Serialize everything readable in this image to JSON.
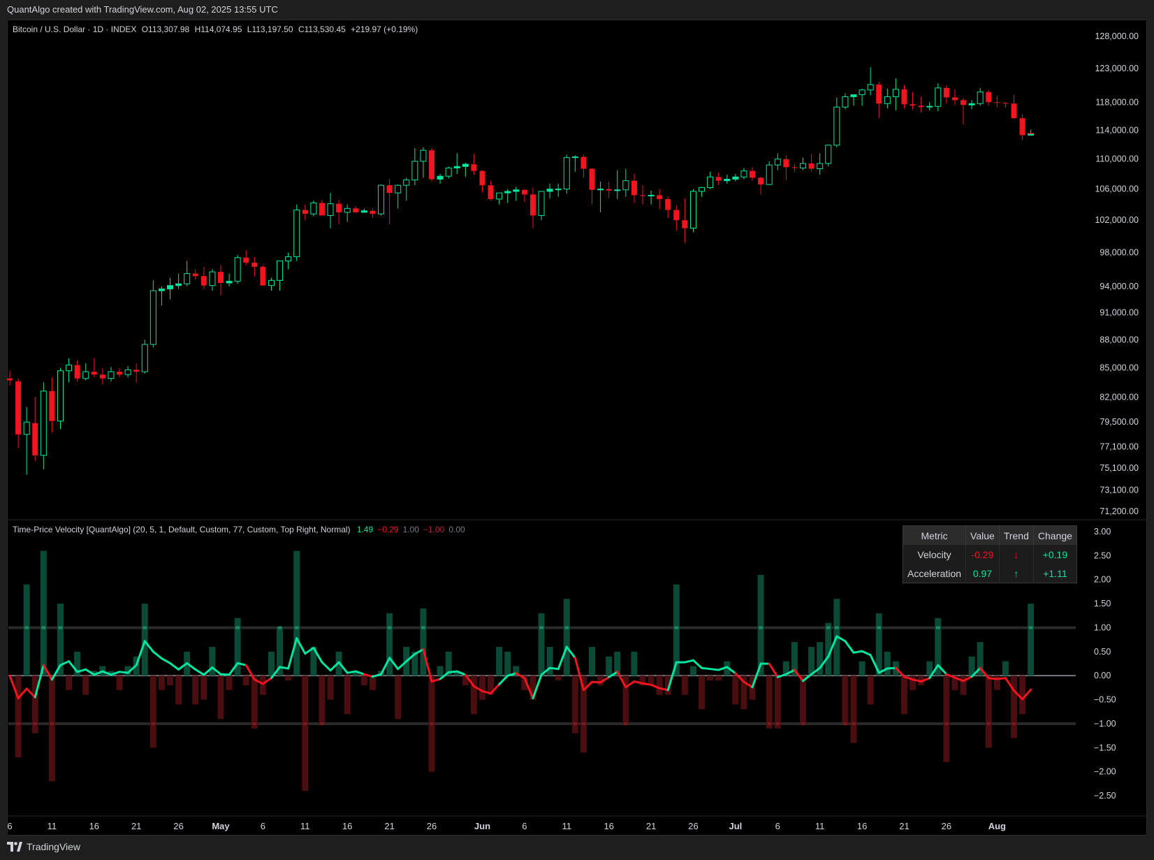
{
  "header": {
    "watermark": "QuantAlgo created with TradingView.com, Aug 02, 2025 13:55 UTC"
  },
  "symbol": {
    "name": "Bitcoin / U.S. Dollar · 1D · INDEX",
    "open": "O113,307.98",
    "high": "H114,074.95",
    "low": "L113,197.50",
    "close": "C113,530.45",
    "change": "+219.97 (+0.19%)"
  },
  "indicator": {
    "name": "Time-Price Velocity [QuantAlgo] (20, 5, 1, Default, Custom, 77, Custom, Top Right, Normal)",
    "values": [
      {
        "text": "1.49",
        "color": "#00e6a0"
      },
      {
        "text": "−0.29",
        "color": "#f2141e"
      },
      {
        "text": "1.00",
        "color": "#787b86"
      },
      {
        "text": "−1.00",
        "color": "#b22833"
      },
      {
        "text": "0.00",
        "color": "#787b86"
      }
    ]
  },
  "table": {
    "headers": [
      "Metric",
      "Value",
      "Trend",
      "Change"
    ],
    "rows": [
      {
        "metric": "Velocity",
        "value": "-0.29",
        "trend": "↓",
        "change": "+0.19",
        "value_color": "neg",
        "trend_color": "neg",
        "change_color": "pos"
      },
      {
        "metric": "Acceleration",
        "value": "0.97",
        "trend": "↑",
        "change": "+1.11",
        "value_color": "pos",
        "trend_color": "pos",
        "change_color": "pos"
      }
    ]
  },
  "colors": {
    "up": "#00e6a0",
    "down": "#f2141e",
    "background": "#000000"
  },
  "footer": {
    "brand": "TradingView"
  },
  "chart_data": [
    {
      "type": "candlestick",
      "y_ticks": [
        "128,000.00",
        "123,000.00",
        "118,000.00",
        "114,000.00",
        "110,000.00",
        "106,000.00",
        "102,000.00",
        "98,000.00",
        "94,000.00",
        "91,000.00",
        "88,000.00",
        "85,000.00",
        "82,000.00",
        "79,500.00",
        "77,100.00",
        "75,100.00",
        "73,100.00",
        "71,200.00"
      ],
      "y_tick_values": [
        128000,
        123000,
        118000,
        114000,
        110000,
        106000,
        102000,
        98000,
        94000,
        91000,
        88000,
        85000,
        82000,
        79500,
        77100,
        75100,
        73100,
        71200
      ],
      "y_scale": "log",
      "x_ticks": [
        "6",
        "11",
        "16",
        "21",
        "26",
        "May",
        "6",
        "11",
        "16",
        "21",
        "26",
        "Jun",
        "6",
        "11",
        "16",
        "21",
        "26",
        "Jul",
        "6",
        "11",
        "16",
        "21",
        "26",
        "Aug"
      ],
      "x_tick_bars": [
        0,
        5,
        10,
        15,
        20,
        25,
        30,
        35,
        40,
        45,
        50,
        56,
        61,
        66,
        71,
        76,
        81,
        86,
        91,
        96,
        101,
        106,
        111,
        117
      ],
      "candles": [
        [
          83900,
          84700,
          83200,
          83700
        ],
        [
          83600,
          83900,
          77000,
          78300
        ],
        [
          78300,
          81000,
          74500,
          79500
        ],
        [
          79400,
          82000,
          75800,
          76300
        ],
        [
          76300,
          83500,
          75000,
          82600
        ],
        [
          82600,
          84000,
          78500,
          79600
        ],
        [
          79600,
          85000,
          78800,
          84700
        ],
        [
          84700,
          86000,
          83500,
          85300
        ],
        [
          85300,
          85800,
          83600,
          83900
        ],
        [
          83900,
          85500,
          83700,
          84600
        ],
        [
          84600,
          86000,
          84000,
          84300
        ],
        [
          84300,
          85000,
          83300,
          83900
        ],
        [
          83900,
          85100,
          83600,
          84600
        ],
        [
          84600,
          85000,
          84000,
          84300
        ],
        [
          84300,
          85200,
          84000,
          84800
        ],
        [
          84800,
          85500,
          83500,
          84600
        ],
        [
          84600,
          88000,
          84400,
          87500
        ],
        [
          87500,
          94700,
          87200,
          93500
        ],
        [
          93500,
          94000,
          91800,
          93700
        ],
        [
          93700,
          95000,
          92500,
          94100
        ],
        [
          94100,
          95500,
          93700,
          94300
        ],
        [
          94300,
          97000,
          94000,
          95500
        ],
        [
          95500,
          96000,
          94800,
          95200
        ],
        [
          95200,
          96300,
          93700,
          94100
        ],
        [
          94100,
          96000,
          93500,
          95700
        ],
        [
          95700,
          96500,
          93000,
          94400
        ],
        [
          94400,
          95500,
          94000,
          94600
        ],
        [
          94600,
          97700,
          94300,
          97400
        ],
        [
          97400,
          98300,
          96500,
          96800
        ],
        [
          96800,
          97500,
          95200,
          96300
        ],
        [
          96300,
          96500,
          94500,
          94100
        ],
        [
          94100,
          95000,
          93500,
          94700
        ],
        [
          94700,
          97000,
          93500,
          97000
        ],
        [
          97000,
          98000,
          96000,
          97500
        ],
        [
          97500,
          104000,
          97000,
          103300
        ],
        [
          103300,
          104000,
          102000,
          102800
        ],
        [
          102800,
          104500,
          102500,
          104200
        ],
        [
          104200,
          104600,
          102700,
          102600
        ],
        [
          102600,
          105500,
          101000,
          104100
        ],
        [
          104100,
          104600,
          101500,
          103000
        ],
        [
          103000,
          104000,
          101800,
          103500
        ],
        [
          103500,
          103800,
          102900,
          103000
        ],
        [
          103000,
          103500,
          103000,
          103200
        ],
        [
          103200,
          103500,
          102300,
          102800
        ],
        [
          102800,
          106600,
          102600,
          106500
        ],
        [
          106500,
          107300,
          101500,
          105500
        ],
        [
          105500,
          106600,
          103500,
          106500
        ],
        [
          106500,
          107500,
          104500,
          107200
        ],
        [
          107200,
          111500,
          106500,
          109700
        ],
        [
          109700,
          111600,
          107500,
          111200
        ],
        [
          111200,
          111500,
          107000,
          107300
        ],
        [
          107300,
          108000,
          106700,
          107700
        ],
        [
          107700,
          109000,
          107400,
          108800
        ],
        [
          108800,
          110800,
          108000,
          109000
        ],
        [
          109000,
          109500,
          107600,
          109300
        ],
        [
          109300,
          110700,
          107900,
          108400
        ],
        [
          108400,
          108500,
          105600,
          106500
        ],
        [
          106500,
          107100,
          104500,
          104700
        ],
        [
          104700,
          105500,
          104000,
          105500
        ],
        [
          105500,
          106000,
          104200,
          105700
        ],
        [
          105700,
          106300,
          104500,
          105900
        ],
        [
          105900,
          106000,
          104300,
          105300
        ],
        [
          105300,
          106200,
          101000,
          102600
        ],
        [
          102600,
          105600,
          102000,
          105700
        ],
        [
          105700,
          106700,
          104800,
          106000
        ],
        [
          106000,
          106700,
          105000,
          106000
        ],
        [
          106000,
          110600,
          105400,
          110200
        ],
        [
          110200,
          110500,
          108300,
          110300
        ],
        [
          110300,
          110600,
          107500,
          108700
        ],
        [
          108700,
          108800,
          104000,
          105900
        ],
        [
          105900,
          107000,
          103000,
          106000
        ],
        [
          106000,
          107000,
          104800,
          105800
        ],
        [
          105800,
          108500,
          104700,
          105900
        ],
        [
          105900,
          108700,
          105000,
          107100
        ],
        [
          107100,
          108000,
          104200,
          105200
        ],
        [
          105200,
          106500,
          104000,
          105100
        ],
        [
          105100,
          105800,
          104000,
          105200
        ],
        [
          105200,
          106000,
          103400,
          104700
        ],
        [
          104700,
          105000,
          102300,
          103300
        ],
        [
          103300,
          103900,
          100700,
          102000
        ],
        [
          102000,
          104800,
          99200,
          101000
        ],
        [
          101000,
          106000,
          100500,
          105700
        ],
        [
          105700,
          106300,
          105000,
          106200
        ],
        [
          106200,
          108300,
          106000,
          107600
        ],
        [
          107600,
          108200,
          106500,
          107100
        ],
        [
          107100,
          107900,
          106700,
          107300
        ],
        [
          107300,
          108000,
          107000,
          107600
        ],
        [
          107600,
          108800,
          107300,
          108400
        ],
        [
          108400,
          108900,
          107100,
          107500
        ],
        [
          107500,
          107600,
          105300,
          106600
        ],
        [
          106600,
          109700,
          106500,
          109200
        ],
        [
          109200,
          110800,
          108500,
          110000
        ],
        [
          110000,
          110500,
          107200,
          108900
        ],
        [
          108900,
          109300,
          108300,
          108800
        ],
        [
          108800,
          110200,
          108500,
          109400
        ],
        [
          109400,
          110700,
          108300,
          108700
        ],
        [
          108700,
          110800,
          107900,
          109400
        ],
        [
          109400,
          112000,
          109000,
          111900
        ],
        [
          111900,
          118700,
          111600,
          117300
        ],
        [
          117300,
          119300,
          117000,
          118800
        ],
        [
          118800,
          119000,
          117500,
          119100
        ],
        [
          119100,
          120000,
          117500,
          119800
        ],
        [
          119800,
          123200,
          119000,
          120600
        ],
        [
          120600,
          121000,
          115700,
          117800
        ],
        [
          117800,
          120000,
          117100,
          118800
        ],
        [
          118800,
          121500,
          116800,
          119900
        ],
        [
          119900,
          120500,
          117100,
          117700
        ],
        [
          117700,
          119500,
          116900,
          117500
        ],
        [
          117500,
          118800,
          116500,
          117300
        ],
        [
          117300,
          118000,
          116800,
          117400
        ],
        [
          117400,
          120800,
          116700,
          120100
        ],
        [
          120100,
          120500,
          117800,
          118700
        ],
        [
          118700,
          119900,
          117600,
          118300
        ],
        [
          118300,
          118600,
          114800,
          117600
        ],
        [
          117600,
          118300,
          117000,
          117800
        ],
        [
          117800,
          120100,
          117500,
          119500
        ],
        [
          119500,
          119800,
          117500,
          118000
        ],
        [
          118000,
          118900,
          117300,
          117900
        ],
        [
          117900,
          118000,
          117200,
          117800
        ],
        [
          117800,
          119100,
          115600,
          115700
        ],
        [
          115700,
          116300,
          112600,
          113300
        ],
        [
          113300,
          114100,
          113200,
          113530
        ]
      ]
    },
    {
      "type": "line+bar",
      "y_ticks": [
        "3.00",
        "2.50",
        "2.00",
        "1.50",
        "1.00",
        "0.50",
        "0.00",
        "−0.50",
        "−1.00",
        "−1.50",
        "−2.00",
        "−2.50"
      ],
      "y_tick_values": [
        3,
        2.5,
        2,
        1.5,
        1,
        0.5,
        0,
        -0.5,
        -1,
        -1.5,
        -2,
        -2.5
      ],
      "levels": [
        1,
        0,
        -1
      ],
      "velocity": [
        0,
        -0.47,
        -0.27,
        -0.45,
        0.22,
        -0.08,
        0.22,
        0.3,
        0.08,
        0.13,
        0.02,
        0.09,
        0.02,
        0.08,
        0.06,
        0.22,
        0.72,
        0.5,
        0.36,
        0.26,
        0.13,
        0.26,
        0.13,
        0.02,
        0.17,
        0.03,
        0.02,
        0.26,
        0.22,
        -0.08,
        -0.17,
        -0.05,
        0.18,
        0.15,
        0.78,
        0.46,
        0.58,
        0.28,
        0.11,
        0.28,
        0.06,
        0.09,
        0.03,
        -0.02,
        0.03,
        0.37,
        0.14,
        0.3,
        0.45,
        0.55,
        -0.12,
        -0.07,
        0.07,
        0.09,
        0.02,
        -0.22,
        -0.32,
        -0.37,
        -0.18,
        0,
        0.05,
        -0.05,
        -0.47,
        0.02,
        0.16,
        0.14,
        0.6,
        0.37,
        -0.3,
        -0.13,
        -0.14,
        -0.03,
        0.08,
        -0.24,
        -0.12,
        -0.16,
        -0.19,
        -0.26,
        -0.3,
        0.28,
        0.28,
        0.32,
        0.16,
        0.14,
        0.12,
        0.18,
        0.05,
        -0.13,
        -0.24,
        0.25,
        0.25,
        -0.03,
        0.03,
        0.12,
        -0.11,
        0.03,
        0.16,
        0.4,
        0.82,
        0.72,
        0.48,
        0.51,
        0.43,
        0.06,
        0.15,
        0.16,
        -0.02,
        -0.08,
        -0.12,
        -0.05,
        0.22,
        0.03,
        -0.04,
        -0.11,
        -0.02,
        0.16,
        -0.05,
        -0.07,
        -0.05,
        -0.31,
        -0.49,
        -0.29
      ],
      "acceleration": [
        0,
        -1.7,
        1.9,
        -1.2,
        2.6,
        -2.2,
        1.5,
        -0.3,
        0.5,
        -0.4,
        0.1,
        0.2,
        0.1,
        -0.3,
        0.2,
        0.4,
        1.5,
        -1.5,
        -0.3,
        -0.2,
        -0.6,
        0.5,
        -0.6,
        -0.5,
        0.6,
        -0.9,
        -0.3,
        1.2,
        -0.2,
        -1.1,
        -0.4,
        0.5,
        1.0,
        -0.1,
        2.6,
        -2.4,
        0.6,
        -1.0,
        -0.5,
        0.5,
        -0.8,
        0.1,
        -0.2,
        -0.3,
        0.1,
        1.3,
        -0.9,
        0.6,
        0.5,
        1.4,
        -2.0,
        0.2,
        0.5,
        0.1,
        -0.2,
        -0.8,
        -0.5,
        -0.4,
        0.6,
        0.5,
        0.2,
        -0.3,
        -0.5,
        1.3,
        0.6,
        -0.1,
        1.6,
        -1.2,
        -1.6,
        0.6,
        -0.2,
        0.4,
        0.5,
        -1.0,
        0.5,
        -0.2,
        -0.2,
        -0.4,
        -0.4,
        1.9,
        -0.4,
        0.2,
        -0.7,
        -0.1,
        -0.1,
        0.3,
        -0.6,
        -0.7,
        -0.5,
        2.1,
        -1.1,
        -1.1,
        0.3,
        0.7,
        -1.0,
        0.6,
        0.7,
        1.1,
        1.6,
        -1.0,
        -1.4,
        0.3,
        -0.6,
        1.3,
        0.5,
        0.3,
        -0.8,
        -0.3,
        -0.2,
        0.3,
        1.2,
        -1.8,
        -0.3,
        -0.4,
        0.4,
        0.7,
        -1.5,
        -0.3,
        0.3,
        -1.3,
        -0.8,
        1.5
      ]
    }
  ]
}
